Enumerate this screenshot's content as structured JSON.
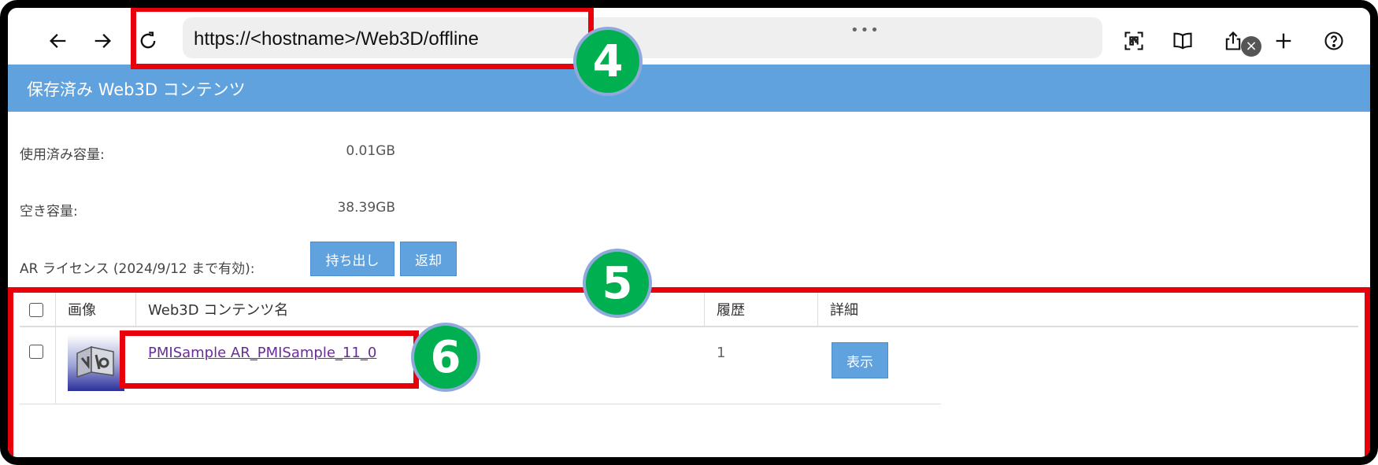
{
  "browser": {
    "url": "https://<hostname>/Web3D/offline",
    "menu_dots": "•••",
    "clear_glyph": "×"
  },
  "page": {
    "title": "保存済み Web3D コンテンツ",
    "used_label": "使用済み容量:",
    "used_value": "0.01GB",
    "free_label": "空き容量:",
    "free_value": "38.39GB",
    "ar_label": "AR ライセンス (2024/9/12 まで有効):",
    "checkout_button": "持ち出し",
    "return_button": "返却"
  },
  "table": {
    "headers": [
      "画像",
      "Web3D コンテンツ名",
      "履歴",
      "詳細"
    ],
    "rows": [
      {
        "name": "PMISample AR_PMISample_11_0",
        "history": "1",
        "detail_button": "表示"
      }
    ]
  },
  "annotations": {
    "badges": [
      "4",
      "5",
      "6"
    ],
    "box_color": "#e8000b",
    "badge_color": "#00b050"
  }
}
